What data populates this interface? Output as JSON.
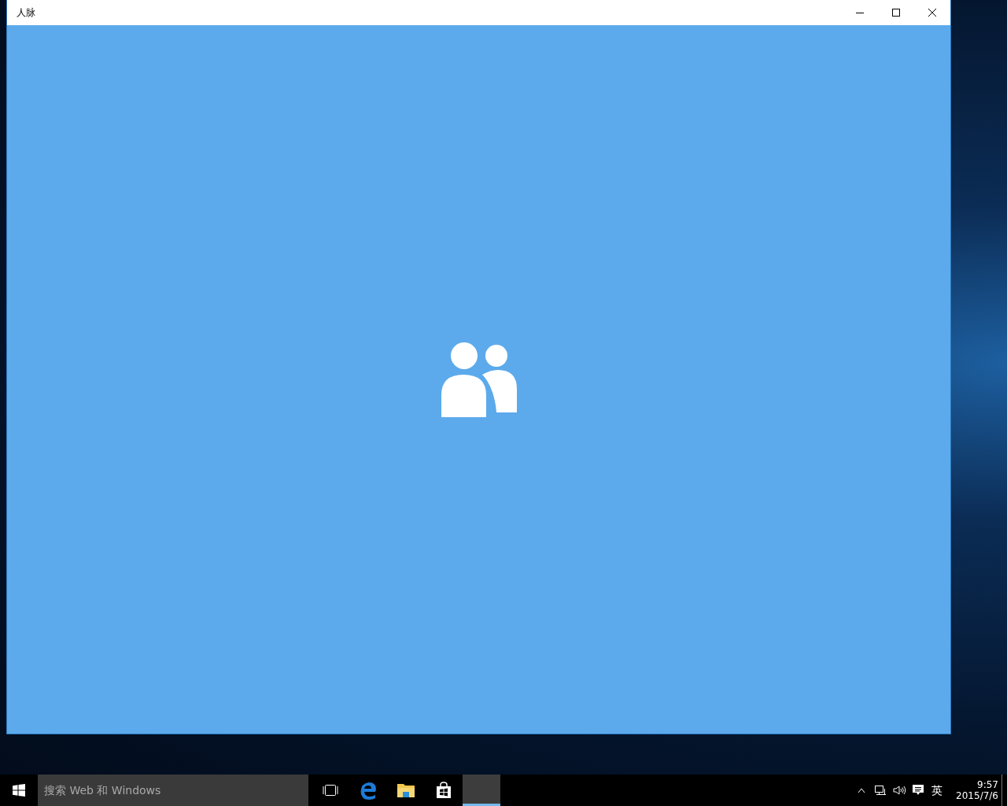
{
  "window": {
    "title": "人脉",
    "splash": {
      "kind": "people"
    }
  },
  "taskbar": {
    "search": {
      "placeholder": "搜索 Web 和 Windows"
    },
    "apps": [
      {
        "kind": "task-view",
        "active": false
      },
      {
        "kind": "edge",
        "active": false
      },
      {
        "kind": "explorer",
        "active": false
      },
      {
        "kind": "store",
        "active": false
      },
      {
        "kind": "blank",
        "active": true
      }
    ],
    "tray": {
      "ime": "英",
      "time": "9:57",
      "date": "2015/7/6"
    }
  }
}
